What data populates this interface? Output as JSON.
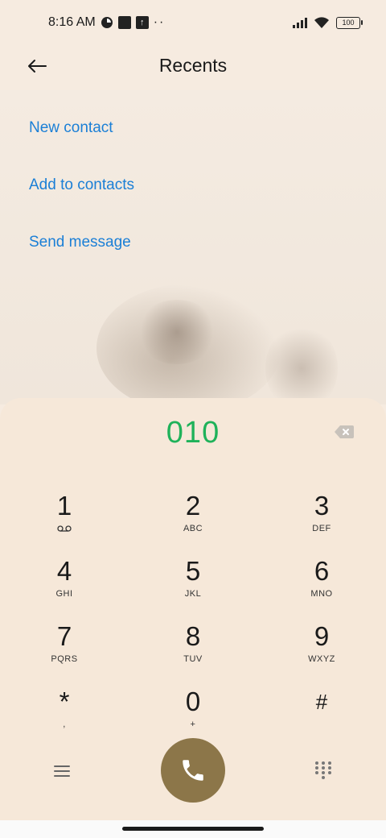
{
  "status_bar": {
    "time": "8:16 AM",
    "battery": "100",
    "icons": [
      "pie-chart-icon",
      "square-app-icon",
      "upload-app-icon",
      "more-dots-icon",
      "signal-icon",
      "wifi-icon",
      "battery-icon"
    ],
    "dots": "··"
  },
  "header": {
    "title": "Recents"
  },
  "actions": {
    "new_contact": "New contact",
    "add_to_contacts": "Add to contacts",
    "send_message": "Send message"
  },
  "dialer": {
    "number": "010",
    "keys": [
      {
        "digit": "1",
        "letters": ""
      },
      {
        "digit": "2",
        "letters": "ABC"
      },
      {
        "digit": "3",
        "letters": "DEF"
      },
      {
        "digit": "4",
        "letters": "GHI"
      },
      {
        "digit": "5",
        "letters": "JKL"
      },
      {
        "digit": "6",
        "letters": "MNO"
      },
      {
        "digit": "7",
        "letters": "PQRS"
      },
      {
        "digit": "8",
        "letters": "TUV"
      },
      {
        "digit": "9",
        "letters": "WXYZ"
      },
      {
        "digit": "*",
        "letters": ","
      },
      {
        "digit": "0",
        "letters": "+"
      },
      {
        "digit": "#",
        "letters": ""
      }
    ]
  },
  "colors": {
    "accent_blue": "#1b7fd6",
    "number_green": "#1fb25a",
    "call_button": "#8c7649",
    "background": "#f6ebe0"
  }
}
